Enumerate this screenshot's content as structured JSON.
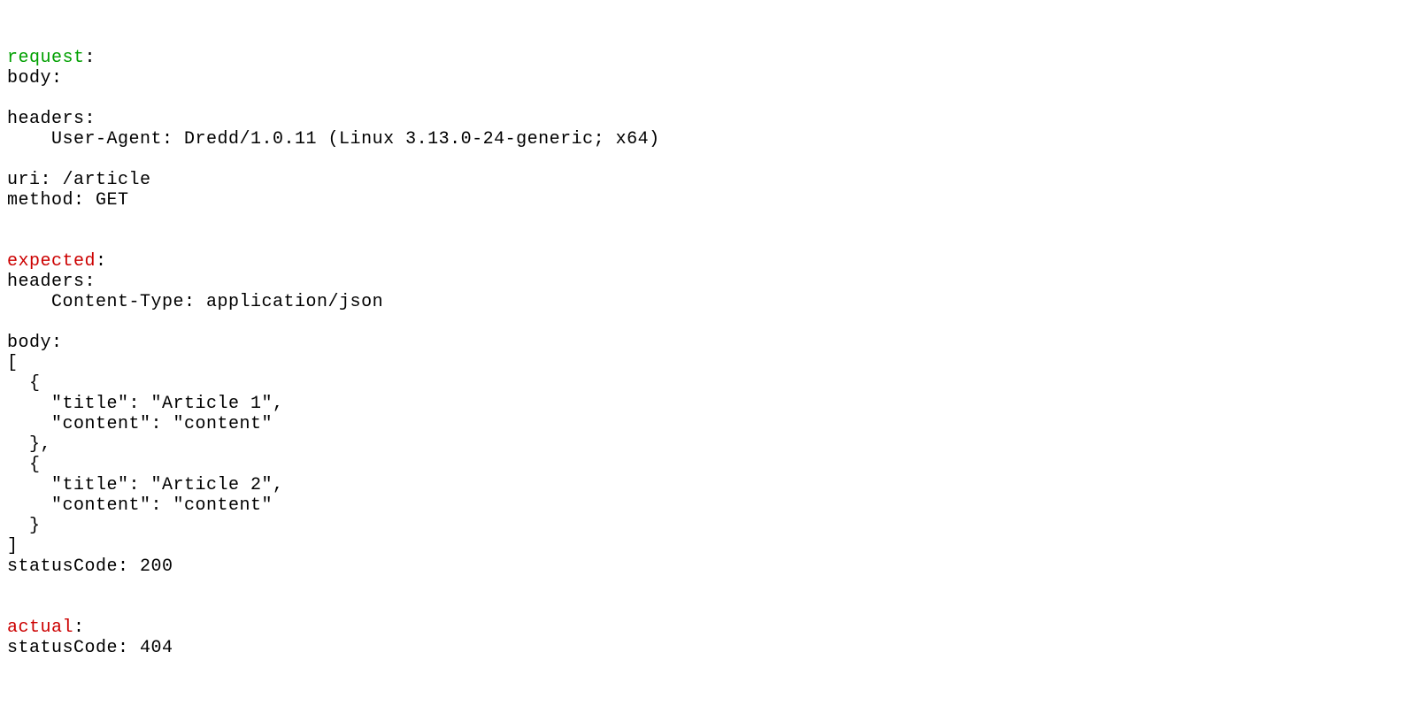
{
  "request": {
    "label": "request",
    "body_label": "body:",
    "headers_label": "headers:",
    "header_line": "    User-Agent: Dredd/1.0.11 (Linux 3.13.0-24-generic; x64)",
    "uri_line": "uri: /article",
    "method_line": "method: GET"
  },
  "expected": {
    "label": "expected",
    "headers_label": "headers:",
    "header_line": "    Content-Type: application/json",
    "body_label": "body:",
    "body_lines": [
      "[",
      "  {",
      "    \"title\": \"Article 1\",",
      "    \"content\": \"content\"",
      "  },",
      "  {",
      "    \"title\": \"Article 2\",",
      "    \"content\": \"content\"",
      "  }",
      "]"
    ],
    "status_line": "statusCode: 200"
  },
  "actual": {
    "label": "actual",
    "status_line": "statusCode: 404"
  }
}
